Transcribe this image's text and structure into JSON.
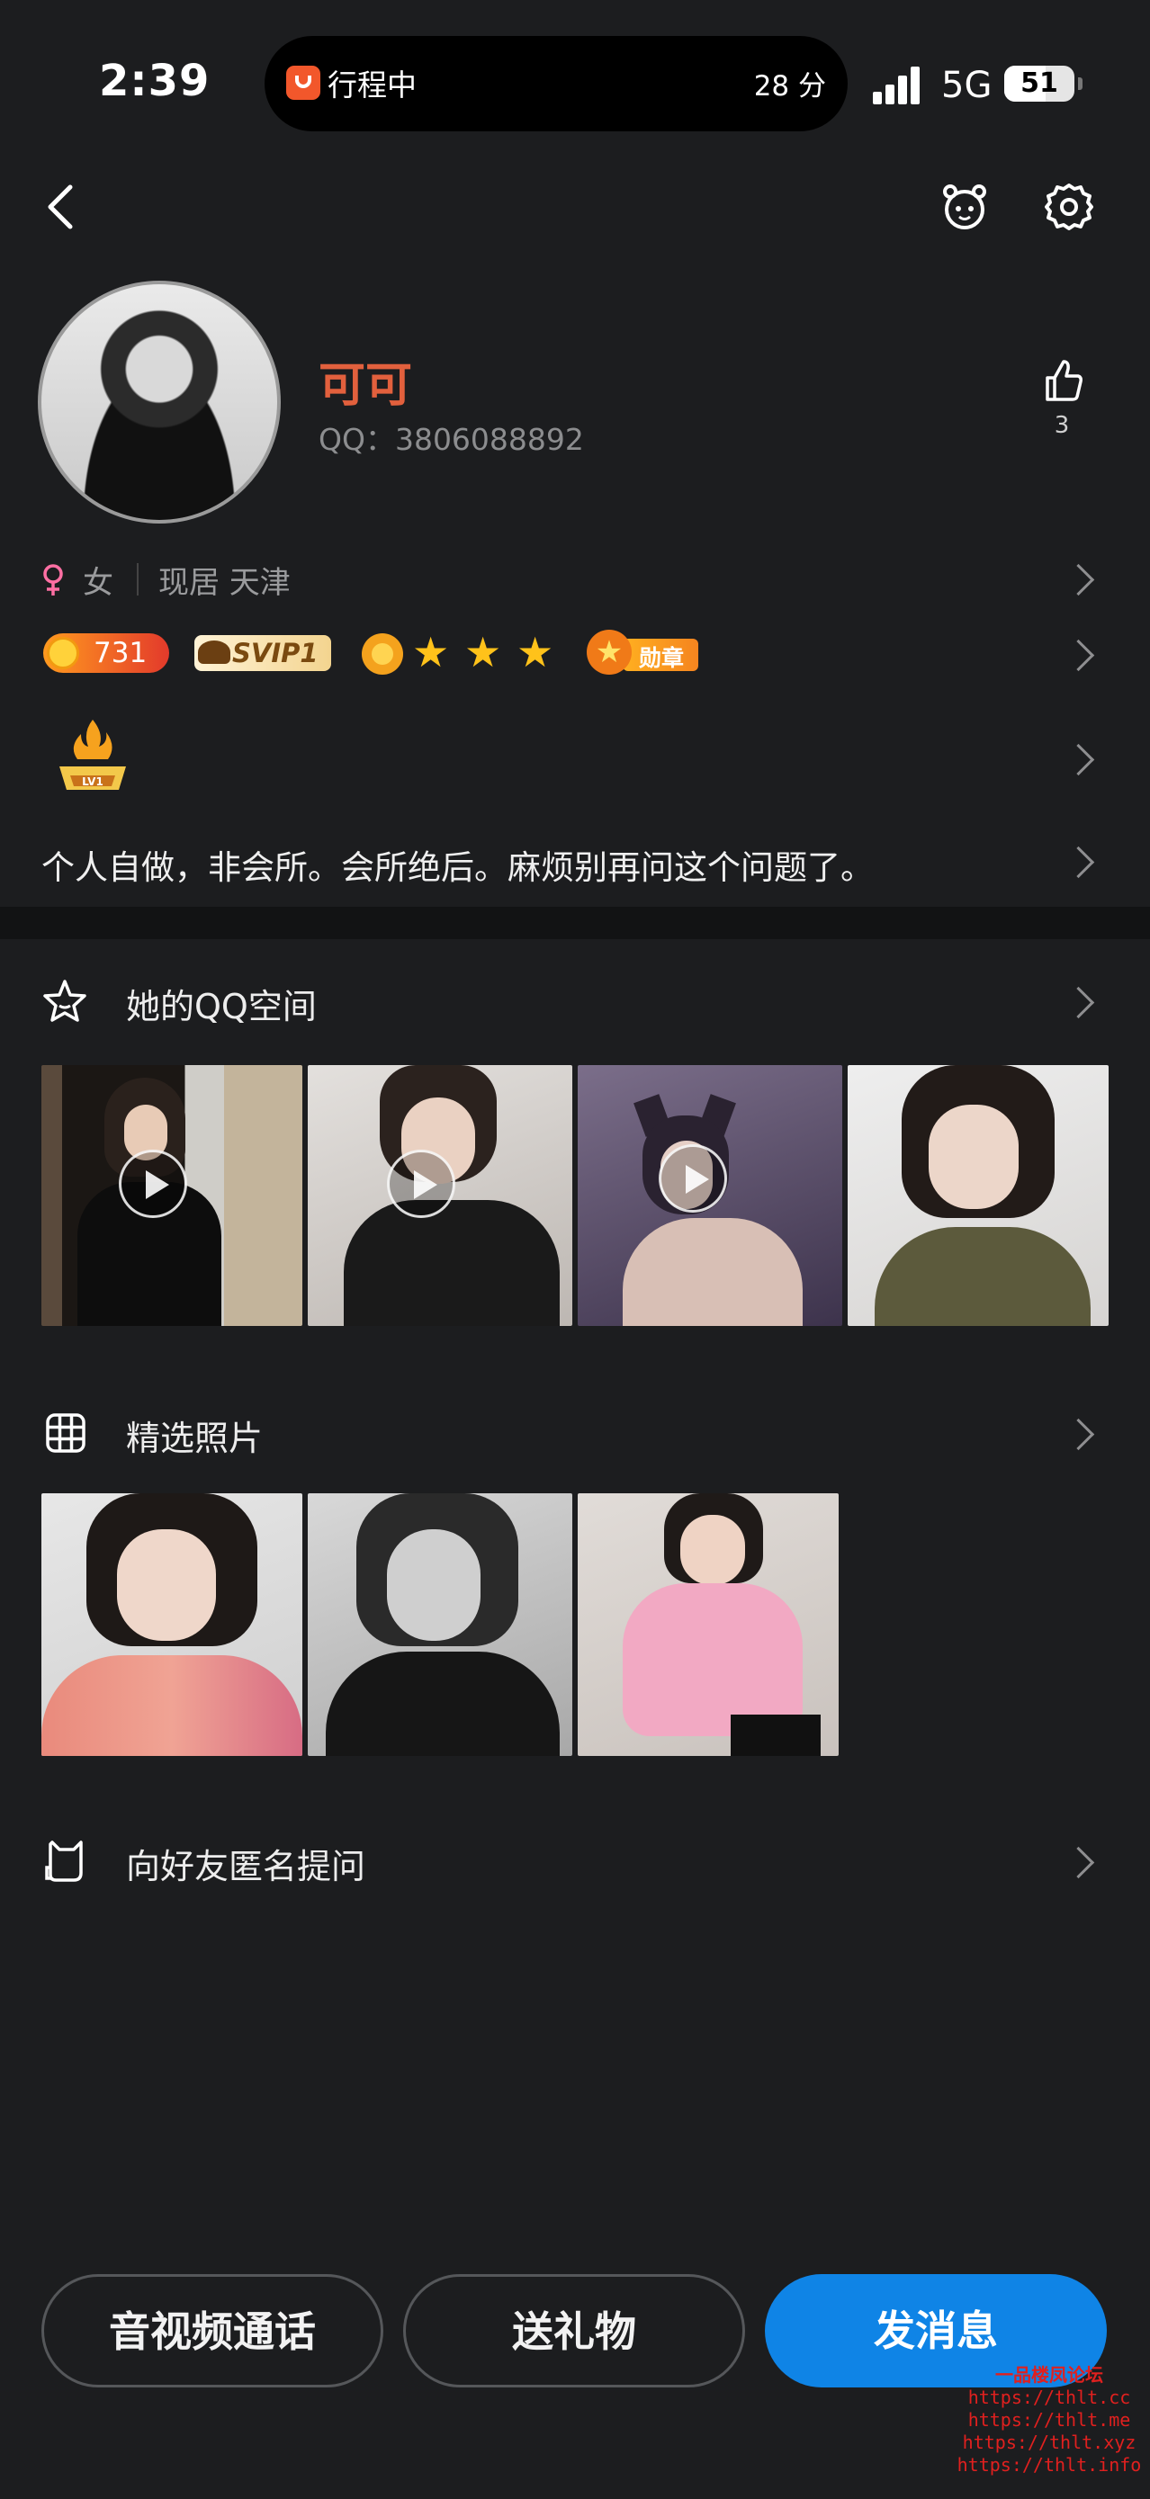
{
  "status_bar": {
    "time": "2:39",
    "live_activity": {
      "label": "行程中",
      "minutes": "28 分"
    },
    "network": "5G",
    "battery": "51"
  },
  "profile": {
    "name": "可可",
    "qq": "QQ：3806088892",
    "likes": "3",
    "gender": "女",
    "location": "现居 天津",
    "level_score": "731",
    "svip": "SVIP1",
    "medal_label": "勋章",
    "bio": "个人自做，非会所。会所绝后。麻烦别再问这个问题了。"
  },
  "sections": {
    "qzone_title": "她的QQ空间",
    "photos_title": "精选照片",
    "anon_title": "向好友匿名提问"
  },
  "actions": {
    "call": "音视频通话",
    "gift": "送礼物",
    "message": "发消息"
  },
  "watermark": [
    "一品楼凤论坛",
    "https://thlt.cc",
    "https://thlt.me",
    "https://thlt.xyz",
    "https://thlt.info"
  ],
  "colors": {
    "name": "#e2603d",
    "primary": "#0f84e6",
    "background": "#1c1d1f"
  }
}
